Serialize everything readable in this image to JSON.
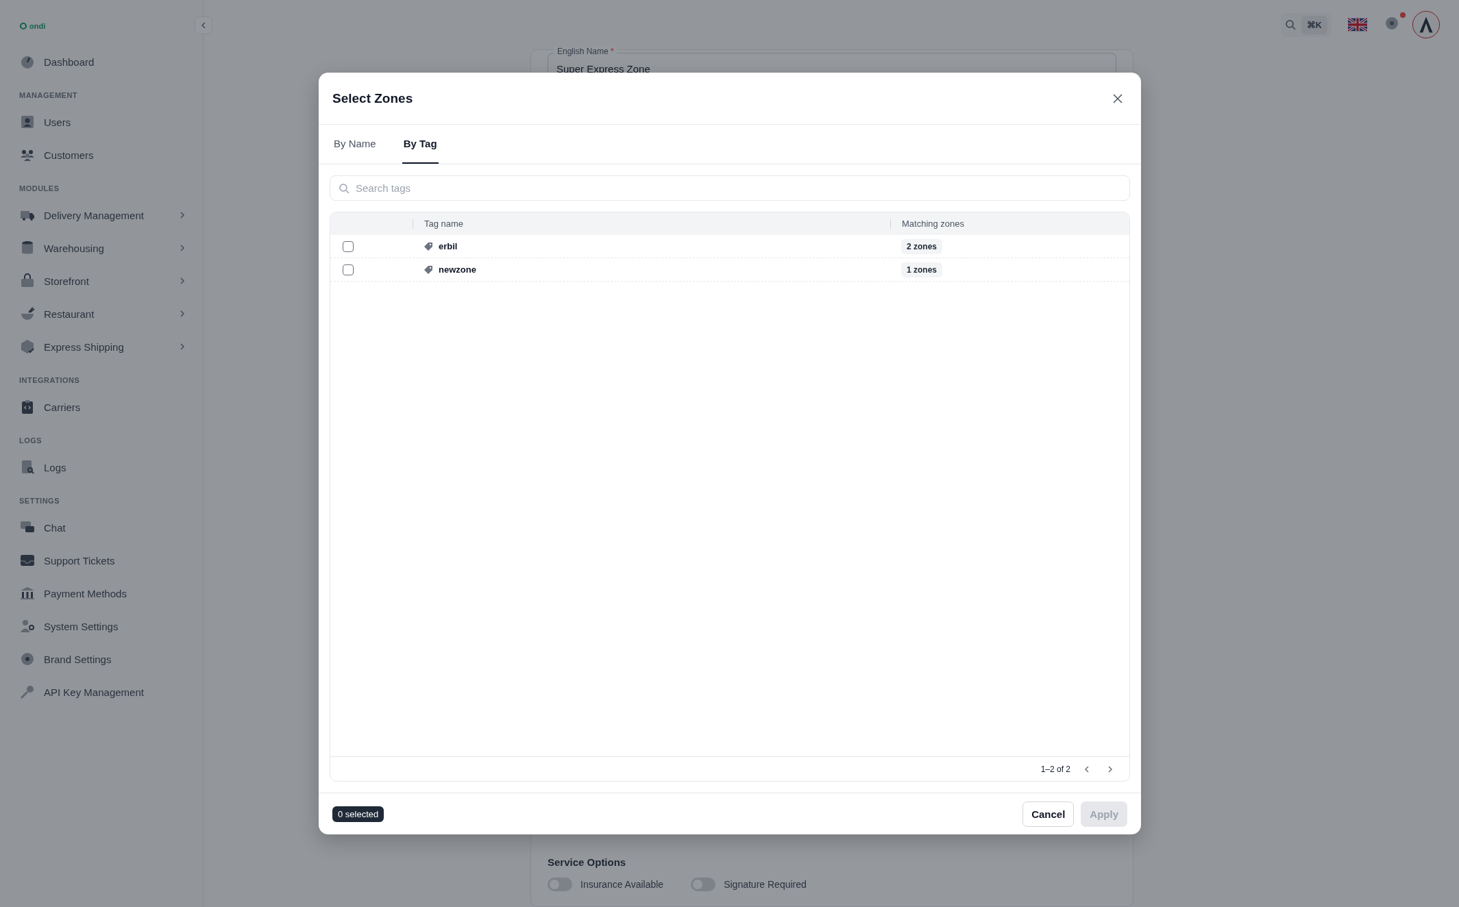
{
  "sidebar": {
    "logo": "ondi",
    "sections": [
      {
        "items": [
          {
            "label": "Dashboard",
            "has_submenu": false
          }
        ]
      },
      {
        "title": "MANAGEMENT",
        "items": [
          {
            "label": "Users",
            "has_submenu": false
          },
          {
            "label": "Customers",
            "has_submenu": false
          }
        ]
      },
      {
        "title": "MODULES",
        "items": [
          {
            "label": "Delivery Management",
            "has_submenu": true
          },
          {
            "label": "Warehousing",
            "has_submenu": true
          },
          {
            "label": "Storefront",
            "has_submenu": true
          },
          {
            "label": "Restaurant",
            "has_submenu": true
          },
          {
            "label": "Express Shipping",
            "has_submenu": true
          }
        ]
      },
      {
        "title": "INTEGRATIONS",
        "items": [
          {
            "label": "Carriers",
            "has_submenu": false
          }
        ]
      },
      {
        "title": "LOGS",
        "items": [
          {
            "label": "Logs",
            "has_submenu": false
          }
        ]
      },
      {
        "title": "SETTINGS",
        "items": [
          {
            "label": "Chat",
            "has_submenu": false
          },
          {
            "label": "Support Tickets",
            "has_submenu": false
          },
          {
            "label": "Payment Methods",
            "has_submenu": false
          },
          {
            "label": "System Settings",
            "has_submenu": false
          },
          {
            "label": "Brand Settings",
            "has_submenu": false
          },
          {
            "label": "API Key Management",
            "has_submenu": false
          }
        ]
      }
    ]
  },
  "topbar": {
    "shortcut": "⌘K",
    "notification": true
  },
  "form": {
    "field_label": "English Name",
    "required_mark": "*",
    "field_value": "Super Express Zone",
    "section_title": "Service Options",
    "toggles": [
      {
        "label": "Insurance Available",
        "on": false
      },
      {
        "label": "Signature Required",
        "on": false
      }
    ]
  },
  "dialog": {
    "title": "Select Zones",
    "tabs": [
      {
        "label": "By Name",
        "selected": false
      },
      {
        "label": "By Tag",
        "selected": true
      }
    ],
    "search": {
      "placeholder": "Search tags"
    },
    "table": {
      "columns": [
        "Tag name",
        "Matching zones"
      ],
      "rows": [
        {
          "name": "erbil",
          "zones": "2 zones",
          "checked": false
        },
        {
          "name": "newzone",
          "zones": "1 zones",
          "checked": false
        }
      ]
    },
    "pagination": "1–2 of 2",
    "selection_count": "0 selected",
    "buttons": [
      {
        "label": "Cancel",
        "disabled": false
      },
      {
        "label": "Apply",
        "disabled": true
      }
    ]
  }
}
